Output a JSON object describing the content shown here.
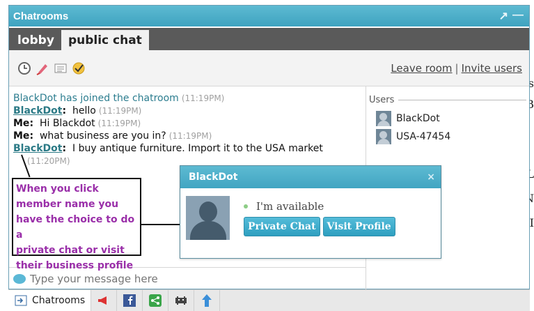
{
  "window": {
    "title": "Chatrooms",
    "controls": [
      "↗",
      "—"
    ]
  },
  "tabs": [
    {
      "label": "lobby",
      "active": false
    },
    {
      "label": "public chat",
      "active": true
    }
  ],
  "toolbar": {
    "icons": [
      "clock-icon",
      "pen-icon",
      "document-icon",
      "check-icon"
    ],
    "leave_label": "Leave room",
    "separator": "|",
    "invite_label": "Invite users"
  },
  "messages": [
    {
      "type": "system",
      "text": "BlackDot has joined the chatroom",
      "time": "(11:19PM)"
    },
    {
      "type": "user",
      "name": "BlackDot",
      "colon": ":",
      "text": "hello",
      "time": "(11:19PM)"
    },
    {
      "type": "me",
      "name": "Me",
      "colon": ":",
      "text": "Hi Blackdot",
      "time": "(11:19PM)"
    },
    {
      "type": "me",
      "name": "Me",
      "colon": ":",
      "text": "what business are you in?",
      "time": "(11:19PM)"
    },
    {
      "type": "user",
      "name": "BlackDot",
      "colon": ":",
      "text": "I buy antique furniture. Import it to the USA market",
      "time": "(11:20PM)"
    }
  ],
  "users": {
    "heading": "Users",
    "list": [
      "BlackDot",
      "USA-47454"
    ]
  },
  "input": {
    "placeholder": "Type your message here"
  },
  "popup": {
    "title": "BlackDot",
    "close": "×",
    "status": "I'm available",
    "private_chat_label": "Private Chat",
    "visit_profile_label": "Visit Profile"
  },
  "note": {
    "lines": [
      "When you click",
      "member name you",
      "have the choice to do a",
      "private chat or visit",
      "their business profile"
    ]
  },
  "taskbar": {
    "chatrooms_label": "Chatrooms",
    "icons": [
      "megaphone-icon",
      "facebook-icon",
      "share-icon",
      "invader-icon",
      "upload-icon"
    ]
  },
  "colors": {
    "header": "#4fb1cd",
    "tabbar": "#5a5a5a",
    "username": "#2b7a86",
    "note_text": "#9a2fa9",
    "button": "#3aa8c9"
  }
}
